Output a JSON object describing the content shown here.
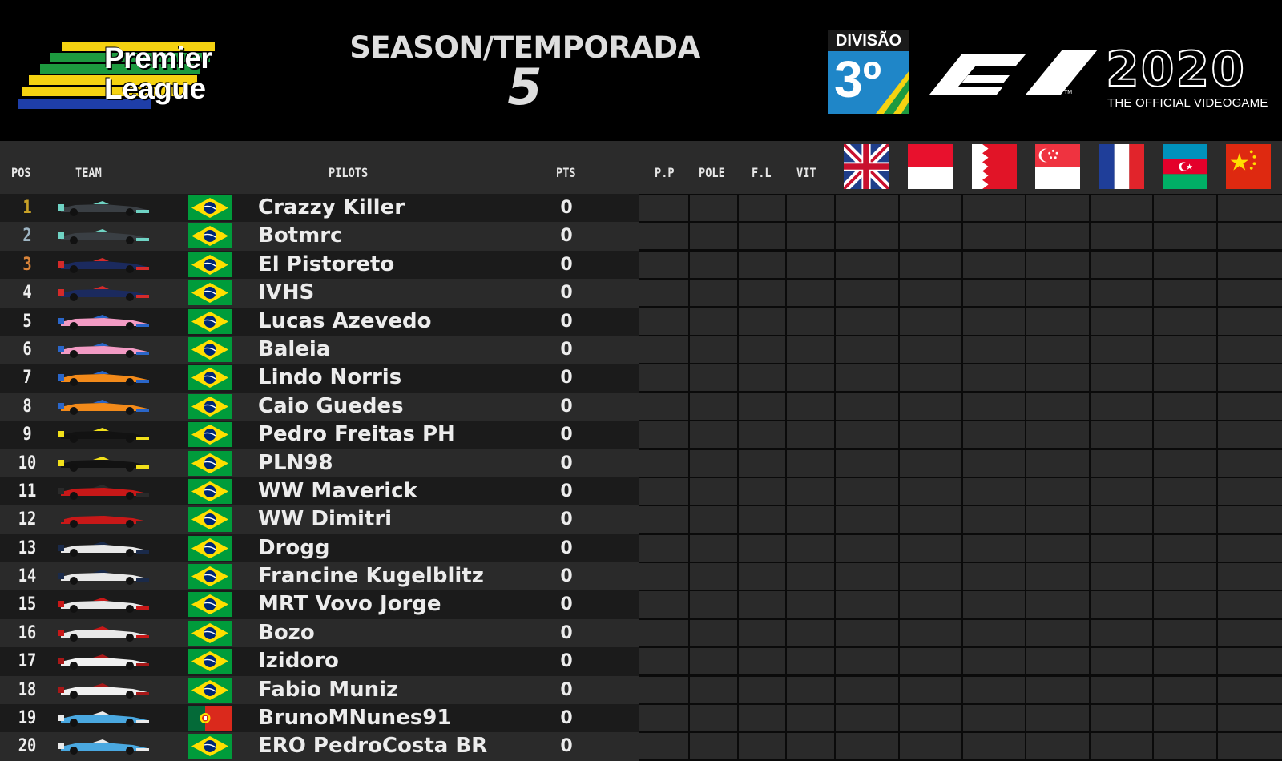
{
  "header": {
    "league_line1": "Premier",
    "league_line2": "League",
    "season_title": "SEASON/TEMPORADA",
    "season_number": "5",
    "division_label": "DIVISÃO",
    "division_number": "3º",
    "game_year": "2020",
    "game_subtitle": "THE OFFICIAL VIDEOGAME"
  },
  "columns": {
    "pos": "POS",
    "team": "TEAM",
    "pilots": "PILOTS",
    "pts": "PTS",
    "pp": "P.P",
    "pole": "POLE",
    "fl": "F.L",
    "vit": "VIT"
  },
  "races": [
    {
      "icon": "uk-flag-icon"
    },
    {
      "icon": "monaco-flag-icon"
    },
    {
      "icon": "bahrain-flag-icon"
    },
    {
      "icon": "singapore-flag-icon"
    },
    {
      "icon": "france-flag-icon"
    },
    {
      "icon": "azerbaijan-flag-icon"
    },
    {
      "icon": "china-flag-icon"
    }
  ],
  "standings": [
    {
      "pos": "1",
      "team": "mercedes",
      "nationality": "brazil",
      "pilot": "Crazzy Killer",
      "pts": "0"
    },
    {
      "pos": "2",
      "team": "mercedes",
      "nationality": "brazil",
      "pilot": "Botmrc",
      "pts": "0"
    },
    {
      "pos": "3",
      "team": "redbull",
      "nationality": "brazil",
      "pilot": "El Pistoreto",
      "pts": "0"
    },
    {
      "pos": "4",
      "team": "redbull",
      "nationality": "brazil",
      "pilot": "IVHS",
      "pts": "0"
    },
    {
      "pos": "5",
      "team": "racingpoint",
      "nationality": "brazil",
      "pilot": "Lucas Azevedo",
      "pts": "0"
    },
    {
      "pos": "6",
      "team": "racingpoint",
      "nationality": "brazil",
      "pilot": "Baleia",
      "pts": "0"
    },
    {
      "pos": "7",
      "team": "mclaren",
      "nationality": "brazil",
      "pilot": "Lindo Norris",
      "pts": "0"
    },
    {
      "pos": "8",
      "team": "mclaren",
      "nationality": "brazil",
      "pilot": "Caio Guedes",
      "pts": "0"
    },
    {
      "pos": "9",
      "team": "renault",
      "nationality": "brazil",
      "pilot": "Pedro Freitas PH",
      "pts": "0"
    },
    {
      "pos": "10",
      "team": "renault",
      "nationality": "brazil",
      "pilot": "PLN98",
      "pts": "0"
    },
    {
      "pos": "11",
      "team": "ferrari",
      "nationality": "brazil",
      "pilot": "WW Maverick",
      "pts": "0"
    },
    {
      "pos": "12",
      "team": "ferrari",
      "nationality": "brazil",
      "pilot": "WW Dimitri",
      "pts": "0"
    },
    {
      "pos": "13",
      "team": "alphatauri",
      "nationality": "brazil",
      "pilot": "Drogg",
      "pts": "0"
    },
    {
      "pos": "14",
      "team": "alphatauri",
      "nationality": "brazil",
      "pilot": "Francine Kugelblitz",
      "pts": "0"
    },
    {
      "pos": "15",
      "team": "haas",
      "nationality": "brazil",
      "pilot": "MRT Vovo Jorge",
      "pts": "0"
    },
    {
      "pos": "16",
      "team": "haas",
      "nationality": "brazil",
      "pilot": "Bozo",
      "pts": "0"
    },
    {
      "pos": "17",
      "team": "alfaromeo",
      "nationality": "brazil",
      "pilot": "Izidoro",
      "pts": "0"
    },
    {
      "pos": "18",
      "team": "alfaromeo",
      "nationality": "brazil",
      "pilot": "Fabio Muniz",
      "pts": "0"
    },
    {
      "pos": "19",
      "team": "williams",
      "nationality": "portugal",
      "pilot": "BrunoMNunes91",
      "pts": "0"
    },
    {
      "pos": "20",
      "team": "williams",
      "nationality": "brazil",
      "pilot": "ERO PedroCosta BR",
      "pts": "0"
    }
  ],
  "colors": {
    "pos_gold": "#c9a227",
    "pos_silver": "#9fb6c4",
    "pos_bronze": "#d9843a",
    "row_dark": "#1b1b1b",
    "row_light": "#2a2a2a",
    "cell": "#2a2a2a",
    "grid_line": "#0a0a0a",
    "teams": {
      "mercedes": [
        "#3a3f44",
        "#6fd3c4"
      ],
      "redbull": [
        "#1b2a5e",
        "#d42a2a"
      ],
      "racingpoint": [
        "#f29bc4",
        "#2a66c9"
      ],
      "mclaren": [
        "#f28a1a",
        "#2a66c9"
      ],
      "renault": [
        "#121212",
        "#f2e01a"
      ],
      "ferrari": [
        "#c81818",
        "#2a2a2a"
      ],
      "alphatauri": [
        "#e8e8e8",
        "#1a2a4a"
      ],
      "haas": [
        "#e8e8e8",
        "#c81818"
      ],
      "alfaromeo": [
        "#f0f0f0",
        "#a81818"
      ],
      "williams": [
        "#4aa8e0",
        "#eaeaea"
      ]
    }
  }
}
